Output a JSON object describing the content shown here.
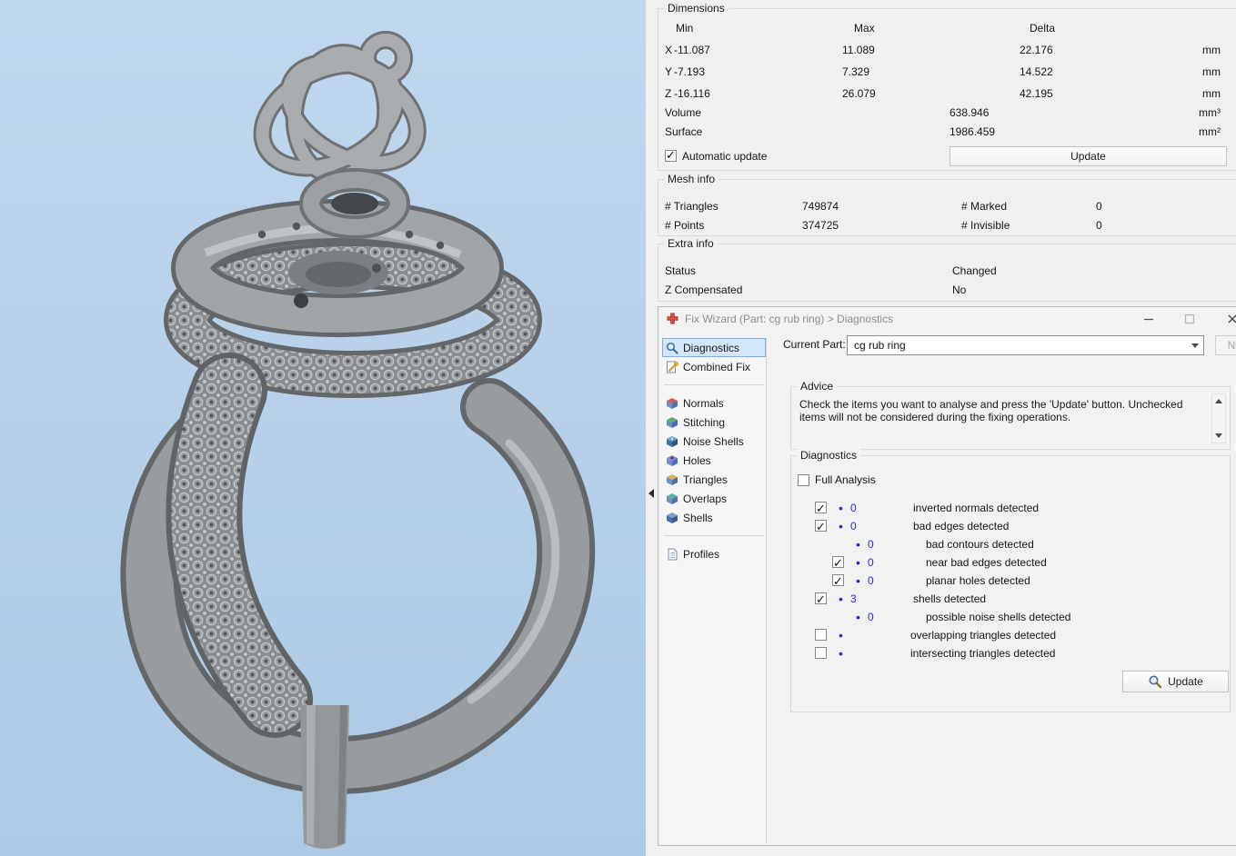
{
  "colors": {
    "viewport_bg": "#b7d1e8",
    "count_blue": "#2a2ace",
    "selection_blue": "#d3e6f8"
  },
  "dimensions": {
    "title": "Dimensions",
    "col_min": "Min",
    "col_max": "Max",
    "col_delta": "Delta",
    "rows": [
      {
        "axis": "X",
        "min": "-11.087",
        "max": "11.089",
        "delta": "22.176",
        "unit": "mm"
      },
      {
        "axis": "Y",
        "min": "-7.193",
        "max": "7.329",
        "delta": "14.522",
        "unit": "mm"
      },
      {
        "axis": "Z",
        "min": "-16.116",
        "max": "26.079",
        "delta": "42.195",
        "unit": "mm"
      }
    ],
    "volume_label": "Volume",
    "volume_value": "638.946",
    "volume_unit": "mm³",
    "surface_label": "Surface",
    "surface_value": "1986.459",
    "surface_unit": "mm²",
    "automatic_update_label": "Automatic update",
    "automatic_update_checked": true,
    "update_button": "Update"
  },
  "mesh_info": {
    "title": "Mesh info",
    "triangles_label": "# Triangles",
    "triangles_value": "749874",
    "points_label": "# Points",
    "points_value": "374725",
    "marked_label": "# Marked",
    "marked_value": "0",
    "invisible_label": "# Invisible",
    "invisible_value": "0"
  },
  "extra_info": {
    "title": "Extra info",
    "status_label": "Status",
    "status_value": "Changed",
    "z_compensated_label": "Z Compensated",
    "z_compensated_value": "No"
  },
  "fix_wizard": {
    "title": "Fix Wizard (Part: cg rub ring) > Diagnostics",
    "current_part_label": "Current Part:",
    "current_part_value": "cg rub ring",
    "next_button": "Next",
    "sidebar": {
      "items_top": [
        {
          "label": "Diagnostics",
          "selected": true
        },
        {
          "label": "Combined Fix",
          "selected": false
        }
      ],
      "tools": [
        "Normals",
        "Stitching",
        "Noise Shells",
        "Holes",
        "Triangles",
        "Overlaps",
        "Shells"
      ],
      "items_bottom": [
        "Profiles"
      ]
    },
    "advice": {
      "title": "Advice",
      "text": "Check the items you want to analyse and press the 'Update' button. Unchecked items will not be considered during the fixing operations."
    },
    "diagnostics": {
      "title": "Diagnostics",
      "full_analysis_label": "Full Analysis",
      "full_analysis_checked": false,
      "items": [
        {
          "has_checkbox": true,
          "checked": true,
          "count": "0",
          "label": "inverted normals detected",
          "sub": false
        },
        {
          "has_checkbox": true,
          "checked": true,
          "count": "0",
          "label": "bad edges detected",
          "sub": false
        },
        {
          "has_checkbox": false,
          "checked": false,
          "count": "0",
          "label": "bad contours detected",
          "sub": true
        },
        {
          "has_checkbox": true,
          "checked": true,
          "count": "0",
          "label": "near bad edges detected",
          "sub": true
        },
        {
          "has_checkbox": true,
          "checked": true,
          "count": "0",
          "label": "planar holes detected",
          "sub": true
        },
        {
          "has_checkbox": true,
          "checked": true,
          "count": "3",
          "label": "shells detected",
          "sub": false
        },
        {
          "has_checkbox": false,
          "checked": false,
          "count": "0",
          "label": "possible noise shells detected",
          "sub": true
        },
        {
          "has_checkbox": true,
          "checked": false,
          "count": "",
          "label": "overlapping triangles detected",
          "sub": false
        },
        {
          "has_checkbox": true,
          "checked": false,
          "count": "",
          "label": "intersecting triangles detected",
          "sub": false
        }
      ],
      "update_button": "Update"
    }
  }
}
